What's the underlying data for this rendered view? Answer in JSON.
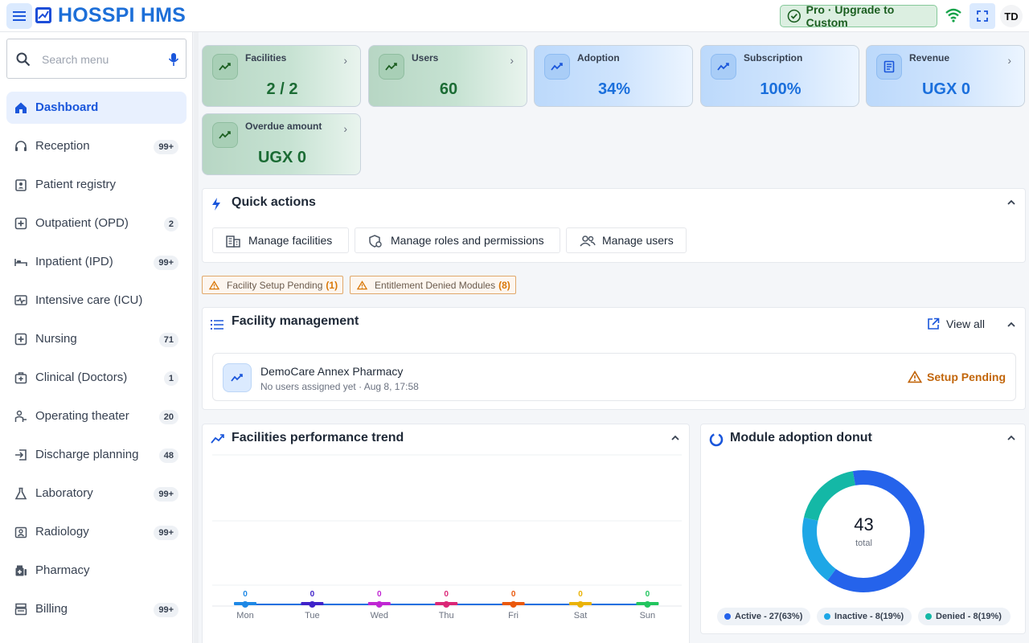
{
  "app": {
    "title": "HOSSPI HMS",
    "upgrade_label": "Pro · Upgrade to Custom",
    "user_initials": "TD"
  },
  "search": {
    "placeholder": "Search menu"
  },
  "sidebar": {
    "items": [
      {
        "label": "Dashboard",
        "badge": ""
      },
      {
        "label": "Reception",
        "badge": "99+"
      },
      {
        "label": "Patient registry",
        "badge": ""
      },
      {
        "label": "Outpatient (OPD)",
        "badge": "2"
      },
      {
        "label": "Inpatient (IPD)",
        "badge": "99+"
      },
      {
        "label": "Intensive care (ICU)",
        "badge": ""
      },
      {
        "label": "Nursing",
        "badge": "71"
      },
      {
        "label": "Clinical (Doctors)",
        "badge": "1"
      },
      {
        "label": "Operating theater",
        "badge": "20"
      },
      {
        "label": "Discharge planning",
        "badge": "48"
      },
      {
        "label": "Laboratory",
        "badge": "99+"
      },
      {
        "label": "Radiology",
        "badge": "99+"
      },
      {
        "label": "Pharmacy",
        "badge": ""
      },
      {
        "label": "Billing",
        "badge": "99+"
      }
    ]
  },
  "stats": [
    {
      "label": "Facilities",
      "value": "2 / 2"
    },
    {
      "label": "Users",
      "value": "60"
    },
    {
      "label": "Adoption",
      "value": "34%"
    },
    {
      "label": "Subscription",
      "value": "100%"
    },
    {
      "label": "Revenue",
      "value": "UGX 0"
    },
    {
      "label": "Overdue amount",
      "value": "UGX 0"
    }
  ],
  "quick_actions": {
    "title": "Quick actions",
    "buttons": [
      "Manage facilities",
      "Manage roles and permissions",
      "Manage users"
    ]
  },
  "alerts": [
    {
      "label": "Facility Setup Pending",
      "count": "(1)"
    },
    {
      "label": "Entitlement Denied Modules",
      "count": "(8)"
    }
  ],
  "facility_management": {
    "title": "Facility management",
    "view_all": "View all",
    "rows": [
      {
        "name": "DemoCare Annex Pharmacy",
        "subtitle": "No users assigned yet · Aug 8, 17:58",
        "status": "Setup Pending"
      }
    ]
  },
  "trend": {
    "title": "Facilities performance trend",
    "chart_data": {
      "type": "line",
      "categories": [
        "Mon",
        "Tue",
        "Wed",
        "Thu",
        "Fri",
        "Sat",
        "Sun"
      ],
      "values": [
        0,
        0,
        0,
        0,
        0,
        0,
        0
      ],
      "point_colors": [
        "#1e88e5",
        "#3f22c9",
        "#c026d3",
        "#db2777",
        "#ea580c",
        "#eab308",
        "#22c55e"
      ]
    }
  },
  "donut": {
    "title": "Module adoption donut",
    "total": "43",
    "total_label": "total",
    "chart_data": {
      "type": "pie",
      "slices": [
        {
          "name": "Active",
          "value": 27,
          "color": "#2563eb"
        },
        {
          "name": "Inactive",
          "value": 8,
          "color": "#1ea7e6"
        },
        {
          "name": "Denied",
          "value": 8,
          "color": "#14b8a6"
        }
      ]
    },
    "legend": [
      "Active - 27(63%)",
      "Inactive - 8(19%)",
      "Denied - 8(19%)"
    ]
  }
}
